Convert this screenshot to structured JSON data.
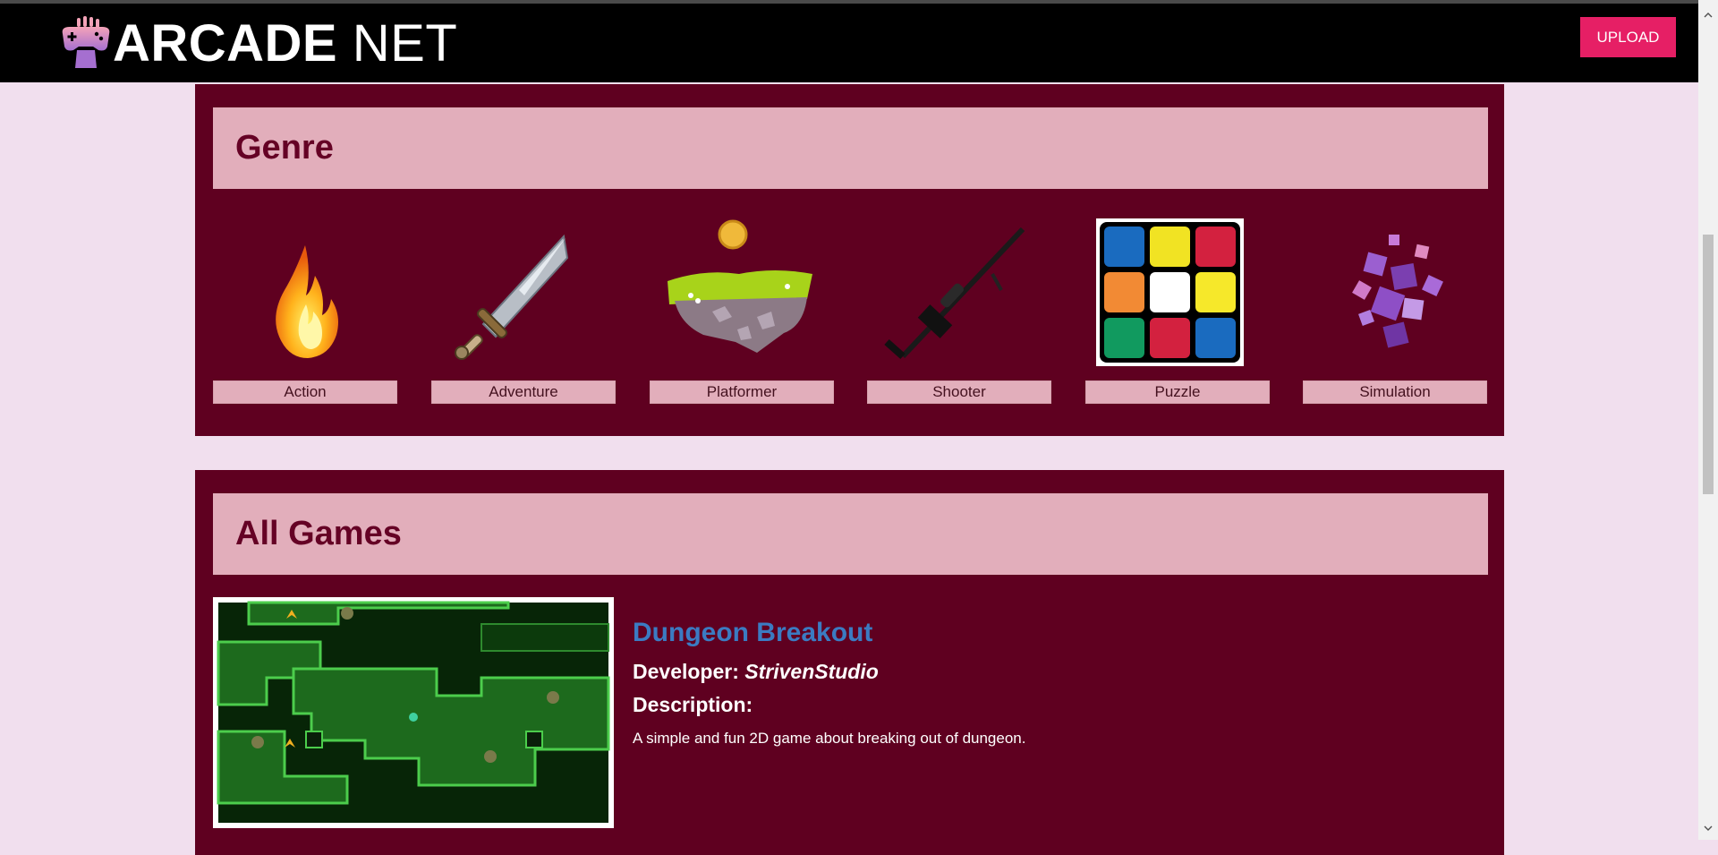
{
  "header": {
    "logo_bold": "ARCADE",
    "logo_light": "NET",
    "upload_label": "UPLOAD"
  },
  "genre_section": {
    "title": "Genre",
    "genres": [
      {
        "label": "Action",
        "icon": "fire-icon"
      },
      {
        "label": "Adventure",
        "icon": "sword-icon"
      },
      {
        "label": "Platformer",
        "icon": "floating-island-icon"
      },
      {
        "label": "Shooter",
        "icon": "sniper-rifle-icon"
      },
      {
        "label": "Puzzle",
        "icon": "rubiks-cube-icon"
      },
      {
        "label": "Simulation",
        "icon": "voxel-cubes-icon"
      }
    ]
  },
  "games_section": {
    "title": "All Games",
    "games": [
      {
        "title": "Dungeon Breakout",
        "developer_label": "Developer:",
        "developer": "StrivenStudio",
        "description_label": "Description:",
        "description": "A simple and fun 2D game about breaking out of dungeon."
      }
    ]
  },
  "colors": {
    "page_bg": "#f1dfee",
    "panel_bg": "#5f0020",
    "panel_header_bg": "#e2aebb",
    "accent_button": "#e61f65",
    "game_title": "#3b7bc2"
  }
}
